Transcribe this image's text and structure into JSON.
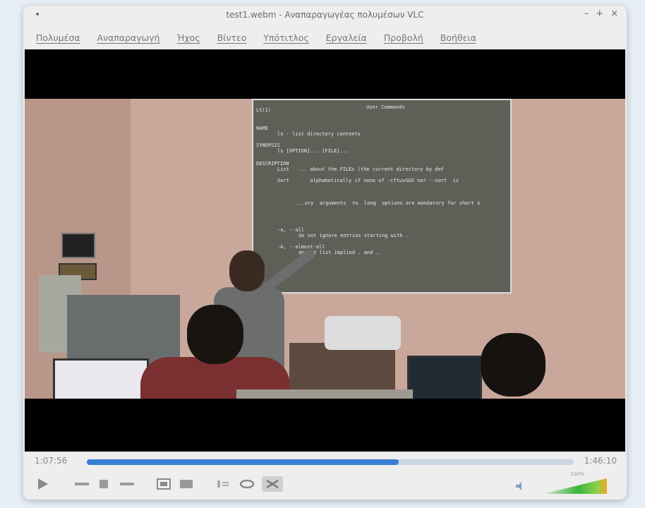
{
  "window": {
    "title": "test1.webm - Αναπαραγωγέας πολυμέσων VLC",
    "menu": [
      "Πολυμέσα",
      "Αναπαραγωγή",
      "Ήχος",
      "Βίντεο",
      "Υπότιτλος",
      "Εργαλεία",
      "Προβολή",
      "Βοήθεια"
    ]
  },
  "projection": {
    "lines": [
      "LS(1)",
      "User Commands",
      "NAME",
      "ls - list directory contents",
      "SYNOPSIS",
      "ls [OPTION]... [FILE]...",
      "DESCRIPTION",
      "List   ... about the FILEs (the current directory by def",
      "Sort       alphabetically if none of -cftuvSUX nor --sort  is",
      "...ory  arguments  to  long  options are mandatory for short o",
      "-a, --all",
      "do not ignore entries starting with .",
      "-A, --almost-all",
      "do not list implied . and .."
    ]
  },
  "player": {
    "elapsed": "1:07:56",
    "total": "1:46:10",
    "progress": 0.64,
    "volume_label": "100%",
    "volume": 1.0,
    "colors": {
      "seek_fill": "#3a7fd5",
      "seek_track": "#c9d6e3",
      "volume_low": "#3db43d",
      "volume_high": "#f5a623"
    }
  }
}
